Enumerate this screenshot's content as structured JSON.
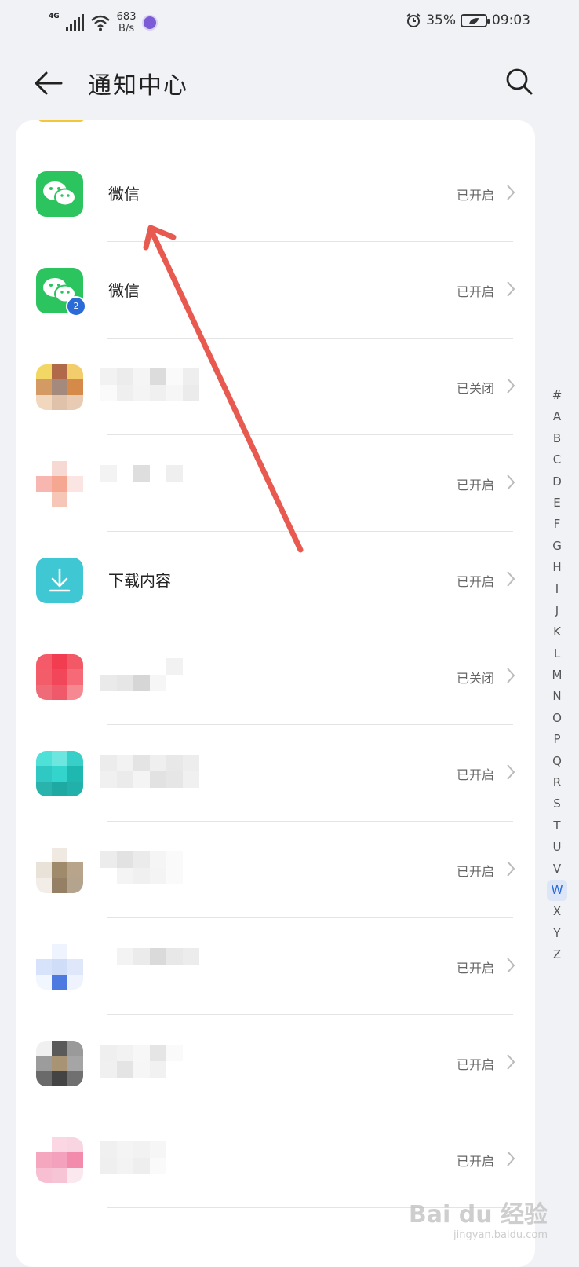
{
  "status_bar": {
    "network_type": "4G",
    "speed_value": "683",
    "speed_unit": "B/s",
    "battery": "35%",
    "time": "09:03"
  },
  "header": {
    "title": "通知中心"
  },
  "rows": [
    {
      "name": "微信",
      "status": "已开启",
      "icon": "wechat-icon"
    },
    {
      "name": "微信",
      "status": "已开启",
      "icon": "wechat-clone-icon",
      "badge": "2"
    },
    {
      "name": "",
      "status": "已关闭",
      "icon": "pixelated-app-icon"
    },
    {
      "name": "",
      "status": "已开启",
      "icon": "pixelated-app-icon"
    },
    {
      "name": "下载内容",
      "status": "已开启",
      "icon": "download-icon"
    },
    {
      "name": "",
      "status": "已关闭",
      "icon": "pixelated-app-icon"
    },
    {
      "name": "",
      "status": "已开启",
      "icon": "pixelated-app-icon"
    },
    {
      "name": "",
      "status": "已开启",
      "icon": "pixelated-app-icon"
    },
    {
      "name": "",
      "status": "已开启",
      "icon": "pixelated-app-icon"
    },
    {
      "name": "",
      "status": "已开启",
      "icon": "pixelated-app-icon"
    },
    {
      "name": "",
      "status": "已开启",
      "icon": "pixelated-app-icon"
    }
  ],
  "alphabet_index": [
    "#",
    "A",
    "B",
    "C",
    "D",
    "E",
    "F",
    "G",
    "H",
    "I",
    "J",
    "K",
    "L",
    "M",
    "N",
    "O",
    "P",
    "Q",
    "R",
    "S",
    "T",
    "U",
    "V",
    "W",
    "X",
    "Y",
    "Z"
  ],
  "active_letter": "W",
  "watermark": {
    "text": "Bai du 经验",
    "sub": "jingyan.baidu.com"
  },
  "colors": {
    "wechat_green": "#2bc45f",
    "download_teal": "#3fc8d3",
    "annotation_red": "#e85a50",
    "accent_blue": "#2b6bd8"
  }
}
